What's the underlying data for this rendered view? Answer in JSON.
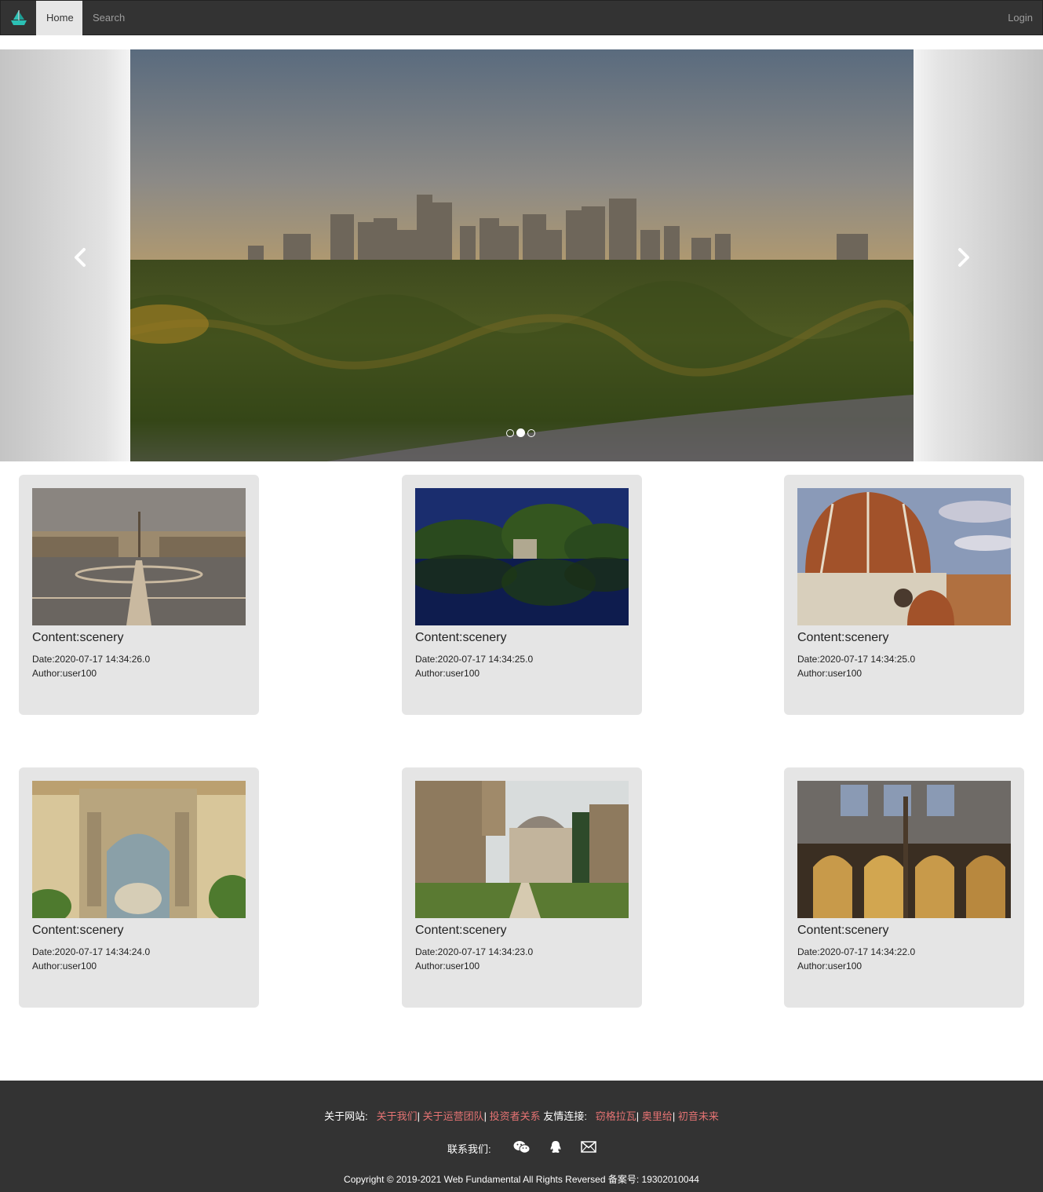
{
  "nav": {
    "brand_icon": "ship-logo-icon",
    "items": [
      {
        "label": "Home",
        "active": true
      },
      {
        "label": "Search",
        "active": false
      }
    ],
    "login": "Login"
  },
  "carousel": {
    "slide_count": 3,
    "active_index": 1,
    "prev_icon": "chevron-left-icon",
    "next_icon": "chevron-right-icon"
  },
  "cards": [
    {
      "content": "Content:scenery",
      "date": "Date:2020-07-17 14:34:26.0",
      "author": "Author:user100"
    },
    {
      "content": "Content:scenery",
      "date": "Date:2020-07-17 14:34:25.0",
      "author": "Author:user100"
    },
    {
      "content": "Content:scenery",
      "date": "Date:2020-07-17 14:34:25.0",
      "author": "Author:user100"
    },
    {
      "content": "Content:scenery",
      "date": "Date:2020-07-17 14:34:24.0",
      "author": "Author:user100"
    },
    {
      "content": "Content:scenery",
      "date": "Date:2020-07-17 14:34:23.0",
      "author": "Author:user100"
    },
    {
      "content": "Content:scenery",
      "date": "Date:2020-07-17 14:34:22.0",
      "author": "Author:user100"
    }
  ],
  "footer": {
    "about_label": "关于网站:",
    "about_links": [
      "关于我们",
      "关于运营团队",
      "投资者关系"
    ],
    "friends_label": "友情连接:",
    "friend_links": [
      "窃格拉瓦",
      "奥里给",
      "初音未来"
    ],
    "contact_label": "联系我们:",
    "contact_icons": [
      "wechat-icon",
      "qq-icon",
      "mail-icon"
    ],
    "copyright": "Copyright © 2019-2021 Web Fundamental All Rights Reversed 备案号:  19302010044"
  },
  "colors": {
    "navbar_bg": "#333333",
    "footer_bg": "#333333",
    "link_red": "#e57373",
    "card_bg": "#e5e5e5"
  }
}
